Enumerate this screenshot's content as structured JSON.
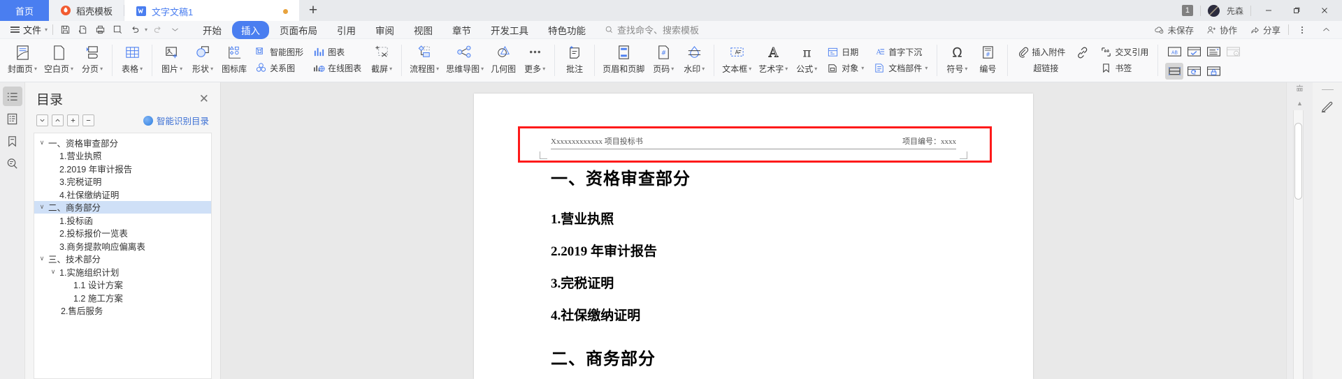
{
  "tabbar": {
    "home_label": "首页",
    "template_label": "稻壳模板",
    "doc_label": "文字文稿1",
    "add_tab_label": "+",
    "notification_count": "1",
    "user_name": "先森"
  },
  "menubar": {
    "file_label": "文件",
    "quick_access": [
      "save-icon",
      "print-preview-icon",
      "print-icon",
      "find-icon",
      "undo-icon",
      "redo-icon",
      "customize-icon"
    ],
    "tabs": [
      {
        "label": "开始",
        "active": false
      },
      {
        "label": "插入",
        "active": true
      },
      {
        "label": "页面布局",
        "active": false
      },
      {
        "label": "引用",
        "active": false
      },
      {
        "label": "审阅",
        "active": false
      },
      {
        "label": "视图",
        "active": false
      },
      {
        "label": "章节",
        "active": false
      },
      {
        "label": "开发工具",
        "active": false
      },
      {
        "label": "特色功能",
        "active": false
      }
    ],
    "search_placeholder": "查找命令、搜索模板",
    "save_status": "未保存",
    "collaborate_label": "协作",
    "share_label": "分享"
  },
  "ribbon": {
    "groups": [
      {
        "items": [
          {
            "label": "封面页",
            "icon": "cover-page-icon",
            "dropdown": true
          },
          {
            "label": "空白页",
            "icon": "blank-page-icon",
            "dropdown": true
          },
          {
            "label": "分页",
            "icon": "page-break-icon",
            "dropdown": true
          }
        ]
      },
      {
        "items": [
          {
            "label": "表格",
            "icon": "table-icon",
            "dropdown": true
          }
        ]
      },
      {
        "items": [
          {
            "label": "图片",
            "icon": "picture-icon",
            "dropdown": true
          },
          {
            "label": "形状",
            "icon": "shapes-icon",
            "dropdown": true
          },
          {
            "label": "图标库",
            "icon": "icon-library-icon",
            "dropdown": false
          }
        ]
      },
      {
        "stacked": [
          {
            "top": {
              "label": "智能图形",
              "icon": "smart-graphic-icon"
            },
            "bottom": {
              "label": "关系图",
              "icon": "relation-chart-icon"
            }
          },
          {
            "top": {
              "label": "图表",
              "icon": "chart-icon"
            },
            "bottom": {
              "label": "在线图表",
              "icon": "online-chart-icon"
            }
          }
        ],
        "items": [
          {
            "label": "截屏",
            "icon": "screenshot-icon",
            "dropdown": true
          }
        ]
      },
      {
        "items": [
          {
            "label": "流程图",
            "icon": "flowchart-icon",
            "dropdown": true
          },
          {
            "label": "思维导图",
            "icon": "mindmap-icon",
            "dropdown": true
          },
          {
            "label": "几何图",
            "icon": "geometry-icon",
            "dropdown": false
          },
          {
            "label": "更多",
            "icon": "more-icon",
            "dropdown": true
          }
        ]
      },
      {
        "items": [
          {
            "label": "批注",
            "icon": "comment-icon",
            "dropdown": false
          }
        ]
      },
      {
        "items": [
          {
            "label": "页眉和页脚",
            "icon": "header-footer-icon",
            "dropdown": false
          },
          {
            "label": "页码",
            "icon": "page-number-icon",
            "dropdown": true
          },
          {
            "label": "水印",
            "icon": "watermark-icon",
            "dropdown": true
          }
        ]
      },
      {
        "items": [
          {
            "label": "文本框",
            "icon": "text-box-icon",
            "dropdown": true
          },
          {
            "label": "艺术字",
            "icon": "word-art-icon",
            "dropdown": true
          },
          {
            "label": "公式",
            "icon": "formula-icon",
            "dropdown": true
          }
        ],
        "stacked": [
          {
            "top": {
              "label": "日期",
              "icon": "date-icon"
            },
            "bottom": {
              "label": "对象",
              "icon": "object-icon"
            }
          },
          {
            "top": {
              "label": "首字下沉",
              "icon": "drop-cap-icon"
            },
            "bottom": {
              "label": "文档部件",
              "icon": "doc-parts-icon"
            }
          }
        ]
      },
      {
        "items": [
          {
            "label": "符号",
            "icon": "symbol-icon",
            "dropdown": true
          },
          {
            "label": "编号",
            "icon": "numbering-icon",
            "dropdown": false
          }
        ]
      },
      {
        "stacked2": [
          {
            "top": {
              "label": "插入附件",
              "icon": "attachment-icon"
            },
            "bottom": {
              "label": "",
              "icon": ""
            }
          },
          {
            "top": {
              "label": "",
              "icon": ""
            },
            "bottom": {
              "label": "超链接",
              "icon": "hyperlink-icon"
            }
          },
          {
            "top": {
              "label": "交叉引用",
              "icon": "cross-reference-icon"
            },
            "bottom": {
              "label": "书签",
              "icon": "bookmark-insert-icon"
            }
          }
        ]
      }
    ],
    "attachment_label": "插入附件",
    "hyperlink_label": "超链接",
    "cross_ref_label": "交叉引用",
    "bookmark_label": "书签",
    "form_controls": [
      {
        "name": "text-field-control-icon",
        "selected": false
      },
      {
        "name": "checkbox-control-icon",
        "selected": false
      },
      {
        "name": "dropdown-control-icon",
        "selected": false
      },
      {
        "name": "info-control-icon",
        "selected": false,
        "disabled": true
      },
      {
        "name": "combo-control-icon",
        "selected": true
      },
      {
        "name": "reset-form-icon",
        "selected": false
      },
      {
        "name": "protect-form-icon",
        "selected": false
      }
    ]
  },
  "rail": {
    "items": [
      {
        "name": "outline-icon",
        "active": true
      },
      {
        "name": "document-map-icon",
        "active": false
      },
      {
        "name": "bookmark-icon",
        "active": false
      },
      {
        "name": "search-doc-icon",
        "active": false
      }
    ]
  },
  "toc": {
    "title": "目录",
    "close_label": "✕",
    "tools": [
      "expand-down-icon",
      "collapse-up-icon",
      "plus-icon",
      "minus-icon"
    ],
    "smart_label": "智能识别目录",
    "items": [
      {
        "label": "一、资格审查部分",
        "level": 0,
        "chevron": true,
        "selected": false
      },
      {
        "label": "1.营业执照",
        "level": 1,
        "chevron": false,
        "selected": false
      },
      {
        "label": "2.2019 年审计报告",
        "level": 1,
        "chevron": false,
        "selected": false
      },
      {
        "label": "3.完税证明",
        "level": 1,
        "chevron": false,
        "selected": false
      },
      {
        "label": "4.社保缴纳证明",
        "level": 1,
        "chevron": false,
        "selected": false
      },
      {
        "label": "二、商务部分",
        "level": 0,
        "chevron": true,
        "selected": true
      },
      {
        "label": "1.投标函",
        "level": 1,
        "chevron": false,
        "selected": false
      },
      {
        "label": "2.投标报价一览表",
        "level": 1,
        "chevron": false,
        "selected": false
      },
      {
        "label": "3.商务提款响应偏离表",
        "level": 1,
        "chevron": false,
        "selected": false
      },
      {
        "label": "三、技术部分",
        "level": 0,
        "chevron": true,
        "selected": false
      },
      {
        "label": "1.实施组织计划",
        "level": 1,
        "chevron": true,
        "selected": false
      },
      {
        "label": "1.1 设计方案",
        "level": 2,
        "chevron": false,
        "selected": false
      },
      {
        "label": "1.2 施工方案",
        "level": 2,
        "chevron": false,
        "selected": false
      },
      {
        "label": "2.售后服务",
        "level": 1,
        "chevron": false,
        "selected": false
      }
    ]
  },
  "document": {
    "header_left": "Xxxxxxxxxxxxx 项目投标书",
    "header_right": "项目编号：xxxx",
    "heading1": "一、资格审查部分",
    "items": [
      "1.营业执照",
      "2.2019 年审计报告",
      "3.完税证明",
      "4.社保缴纳证明"
    ],
    "heading2": "二、商务部分",
    "selection_color": "#fe1a1a"
  }
}
